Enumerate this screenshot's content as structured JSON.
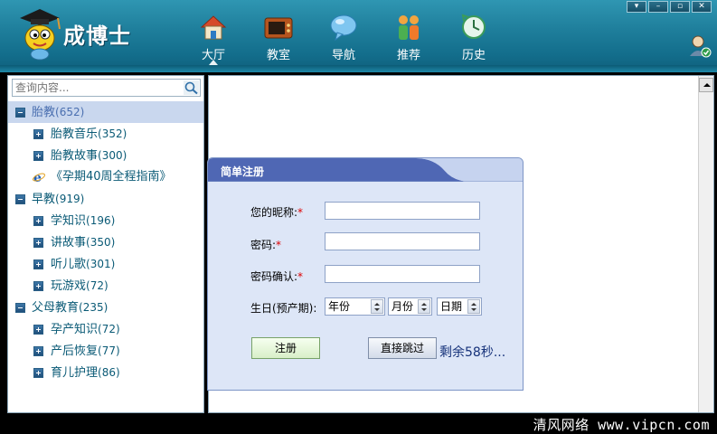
{
  "app": {
    "brand": "成博士"
  },
  "window": {
    "buttons": [
      "▾",
      "–",
      "▫",
      "✕"
    ]
  },
  "nav": [
    {
      "label": "大厅",
      "icon": "house-icon",
      "active": true
    },
    {
      "label": "教室",
      "icon": "tv-icon",
      "active": false
    },
    {
      "label": "导航",
      "icon": "chat-bubble-icon",
      "active": false
    },
    {
      "label": "推荐",
      "icon": "people-icon",
      "active": false
    },
    {
      "label": "历史",
      "icon": "history-icon",
      "active": false
    }
  ],
  "search": {
    "placeholder": "查询内容..."
  },
  "tree": [
    {
      "label": "胎教",
      "count": "(652)"
    },
    {
      "label": "胎教音乐",
      "count": "(352)"
    },
    {
      "label": "胎教故事",
      "count": "(300)"
    },
    {
      "label": "《孕期40周全程指南》",
      "count": ""
    },
    {
      "label": "早教",
      "count": "(919)"
    },
    {
      "label": "学知识",
      "count": "(196)"
    },
    {
      "label": "讲故事",
      "count": "(350)"
    },
    {
      "label": "听儿歌",
      "count": "(301)"
    },
    {
      "label": "玩游戏",
      "count": "(72)"
    },
    {
      "label": "父母教育",
      "count": "(235)"
    },
    {
      "label": "孕产知识",
      "count": "(72)"
    },
    {
      "label": "产后恢复",
      "count": "(77)"
    },
    {
      "label": "育儿护理",
      "count": "(86)"
    }
  ],
  "dialog": {
    "title": "简单注册",
    "nickname_label": "您的昵称:",
    "password_label": "密码:",
    "confirm_label": "密码确认:",
    "required_mark": "*",
    "birthday_label": "生日(预产期):",
    "year_value": "年份",
    "month_value": "月份",
    "day_value": "日期",
    "register_button": "注册",
    "skip_button": "直接跳过",
    "countdown": "剩余58秒..."
  },
  "colors": {
    "header": "#1f7f9c",
    "dialog_bg": "#dde6f7",
    "tree_text": "#0a5a76",
    "selected_row": "#c9d7ee"
  },
  "footer": {
    "watermark": "清风网络 www.vipcn.com"
  }
}
